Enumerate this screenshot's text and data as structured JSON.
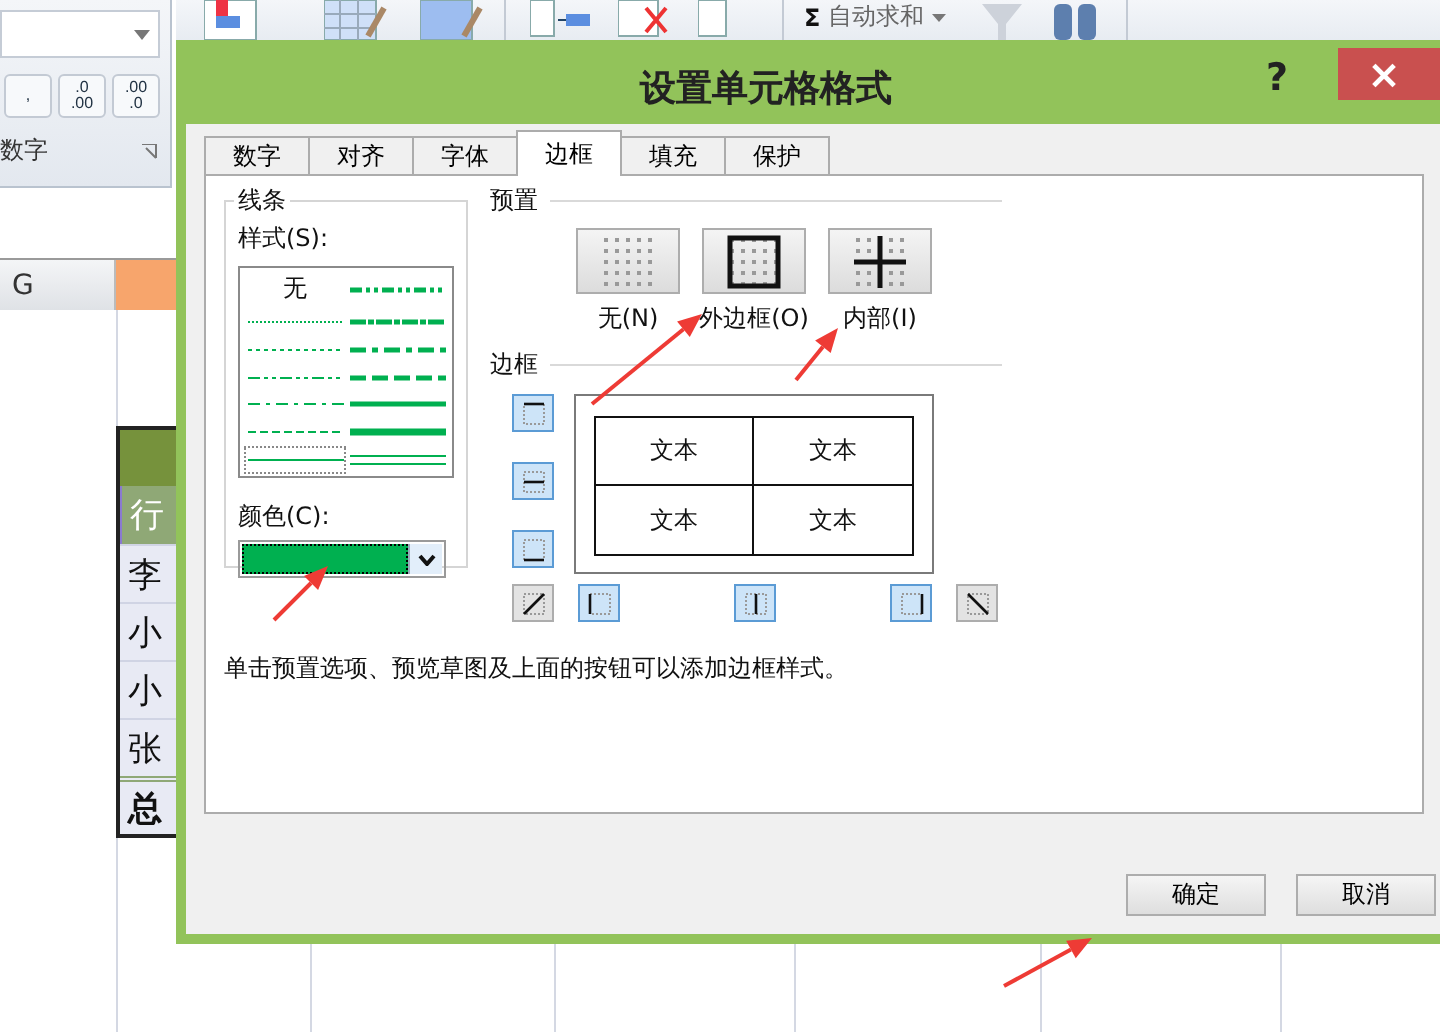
{
  "ribbon": {
    "number_buttons": [
      {
        "lines": [
          ","
        ]
      },
      {
        "lines": [
          ".0",
          ".00"
        ]
      },
      {
        "lines": [
          ".00",
          ".0"
        ]
      }
    ],
    "group_label": "数字",
    "autosum": {
      "icon": "Σ",
      "label": "自动求和"
    }
  },
  "sheet": {
    "column_header": "G",
    "rows": [
      {
        "kind": "header"
      },
      {
        "kind": "title",
        "text": "行"
      },
      {
        "kind": "body",
        "text": "李"
      },
      {
        "kind": "body",
        "text": "小"
      },
      {
        "kind": "body",
        "text": "小"
      },
      {
        "kind": "body",
        "text": "张"
      },
      {
        "kind": "total",
        "text": "总"
      }
    ]
  },
  "dialog": {
    "title": "设置单元格格式",
    "help": "?",
    "close": "×",
    "tabs": [
      {
        "label": "数字",
        "selected": false
      },
      {
        "label": "对齐",
        "selected": false
      },
      {
        "label": "字体",
        "selected": false
      },
      {
        "label": "边框",
        "selected": true
      },
      {
        "label": "填充",
        "selected": false
      },
      {
        "label": "保护",
        "selected": false
      }
    ],
    "line": {
      "title": "线条",
      "style_label": "样式(S):",
      "color_label": "颜色(C):",
      "color": "#00b050",
      "styles": [
        {
          "kind": "none",
          "label": "无",
          "selected": false
        },
        {
          "kind": "hair",
          "selected": false
        },
        {
          "kind": "dotted",
          "selected": false
        },
        {
          "kind": "dashdotdot",
          "selected": false
        },
        {
          "kind": "dashdot",
          "selected": false
        },
        {
          "kind": "dashed",
          "selected": false
        },
        {
          "kind": "thin",
          "selected": true
        },
        {
          "kind": "mediumdashdotdot",
          "selected": false
        },
        {
          "kind": "slantdashdot",
          "selected": false
        },
        {
          "kind": "mediumdashdot",
          "selected": false
        },
        {
          "kind": "mediumdashed",
          "selected": false
        },
        {
          "kind": "medium",
          "selected": false
        },
        {
          "kind": "thick",
          "selected": false
        },
        {
          "kind": "double",
          "selected": false
        }
      ]
    },
    "presets": {
      "title": "预置",
      "items": [
        {
          "kind": "none",
          "label": "无(N)"
        },
        {
          "kind": "outline",
          "label": "外边框(O)"
        },
        {
          "kind": "inside",
          "label": "内部(I)"
        }
      ]
    },
    "border": {
      "title": "边框",
      "buttons": [
        {
          "kind": "top",
          "on": true
        },
        {
          "kind": "middle",
          "on": true
        },
        {
          "kind": "bottom",
          "on": true
        },
        {
          "kind": "diagup",
          "on": false
        },
        {
          "kind": "left",
          "on": true
        },
        {
          "kind": "center",
          "on": true
        },
        {
          "kind": "right",
          "on": true
        },
        {
          "kind": "diagdown",
          "on": false
        }
      ],
      "cells": [
        "文本",
        "文本",
        "文本",
        "文本"
      ]
    },
    "hint": "单击预置选项、预览草图及上面的按钮可以添加边框样式。",
    "buttons": [
      "确定",
      "取消"
    ]
  }
}
